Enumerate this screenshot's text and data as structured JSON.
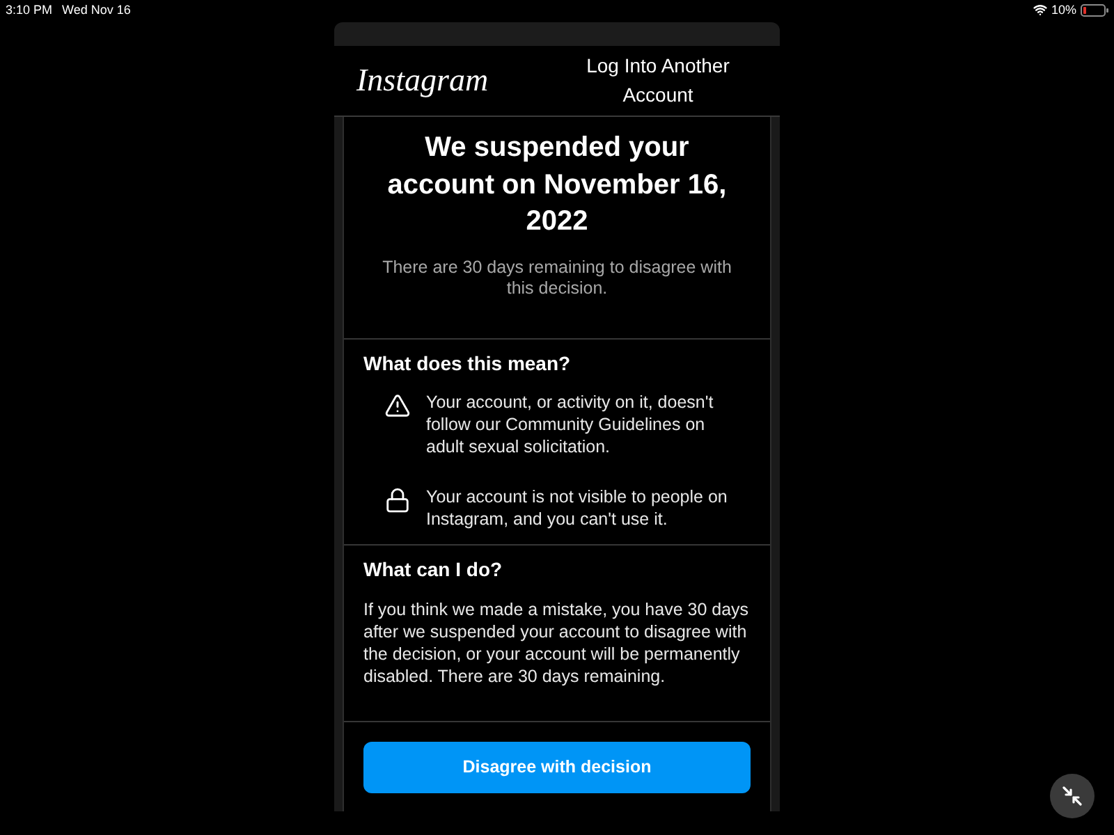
{
  "status_bar": {
    "time": "3:10 PM",
    "date": "Wed Nov 16",
    "battery": "10%"
  },
  "header": {
    "logo": "Instagram",
    "link": "Log Into Another Account"
  },
  "notice": {
    "title": "We suspended your account on November 16, 2022",
    "subtitle": "There are 30 days remaining to disagree with this decision."
  },
  "meaning": {
    "heading": "What does this mean?",
    "items": [
      {
        "kind": "warning",
        "text": "Your account, or activity on it, doesn't follow our Community Guidelines on adult sexual solicitation."
      },
      {
        "kind": "lock",
        "text": "Your account is not visible to people on Instagram, and you can't use it."
      }
    ]
  },
  "next_steps": {
    "heading": "What can I do?",
    "body": "If you think we made a mistake, you have 30 days after we suspended your account to disagree with the decision, or your account will be permanently disabled. There are 30 days remaining."
  },
  "button": {
    "label": "Disagree with decision"
  }
}
